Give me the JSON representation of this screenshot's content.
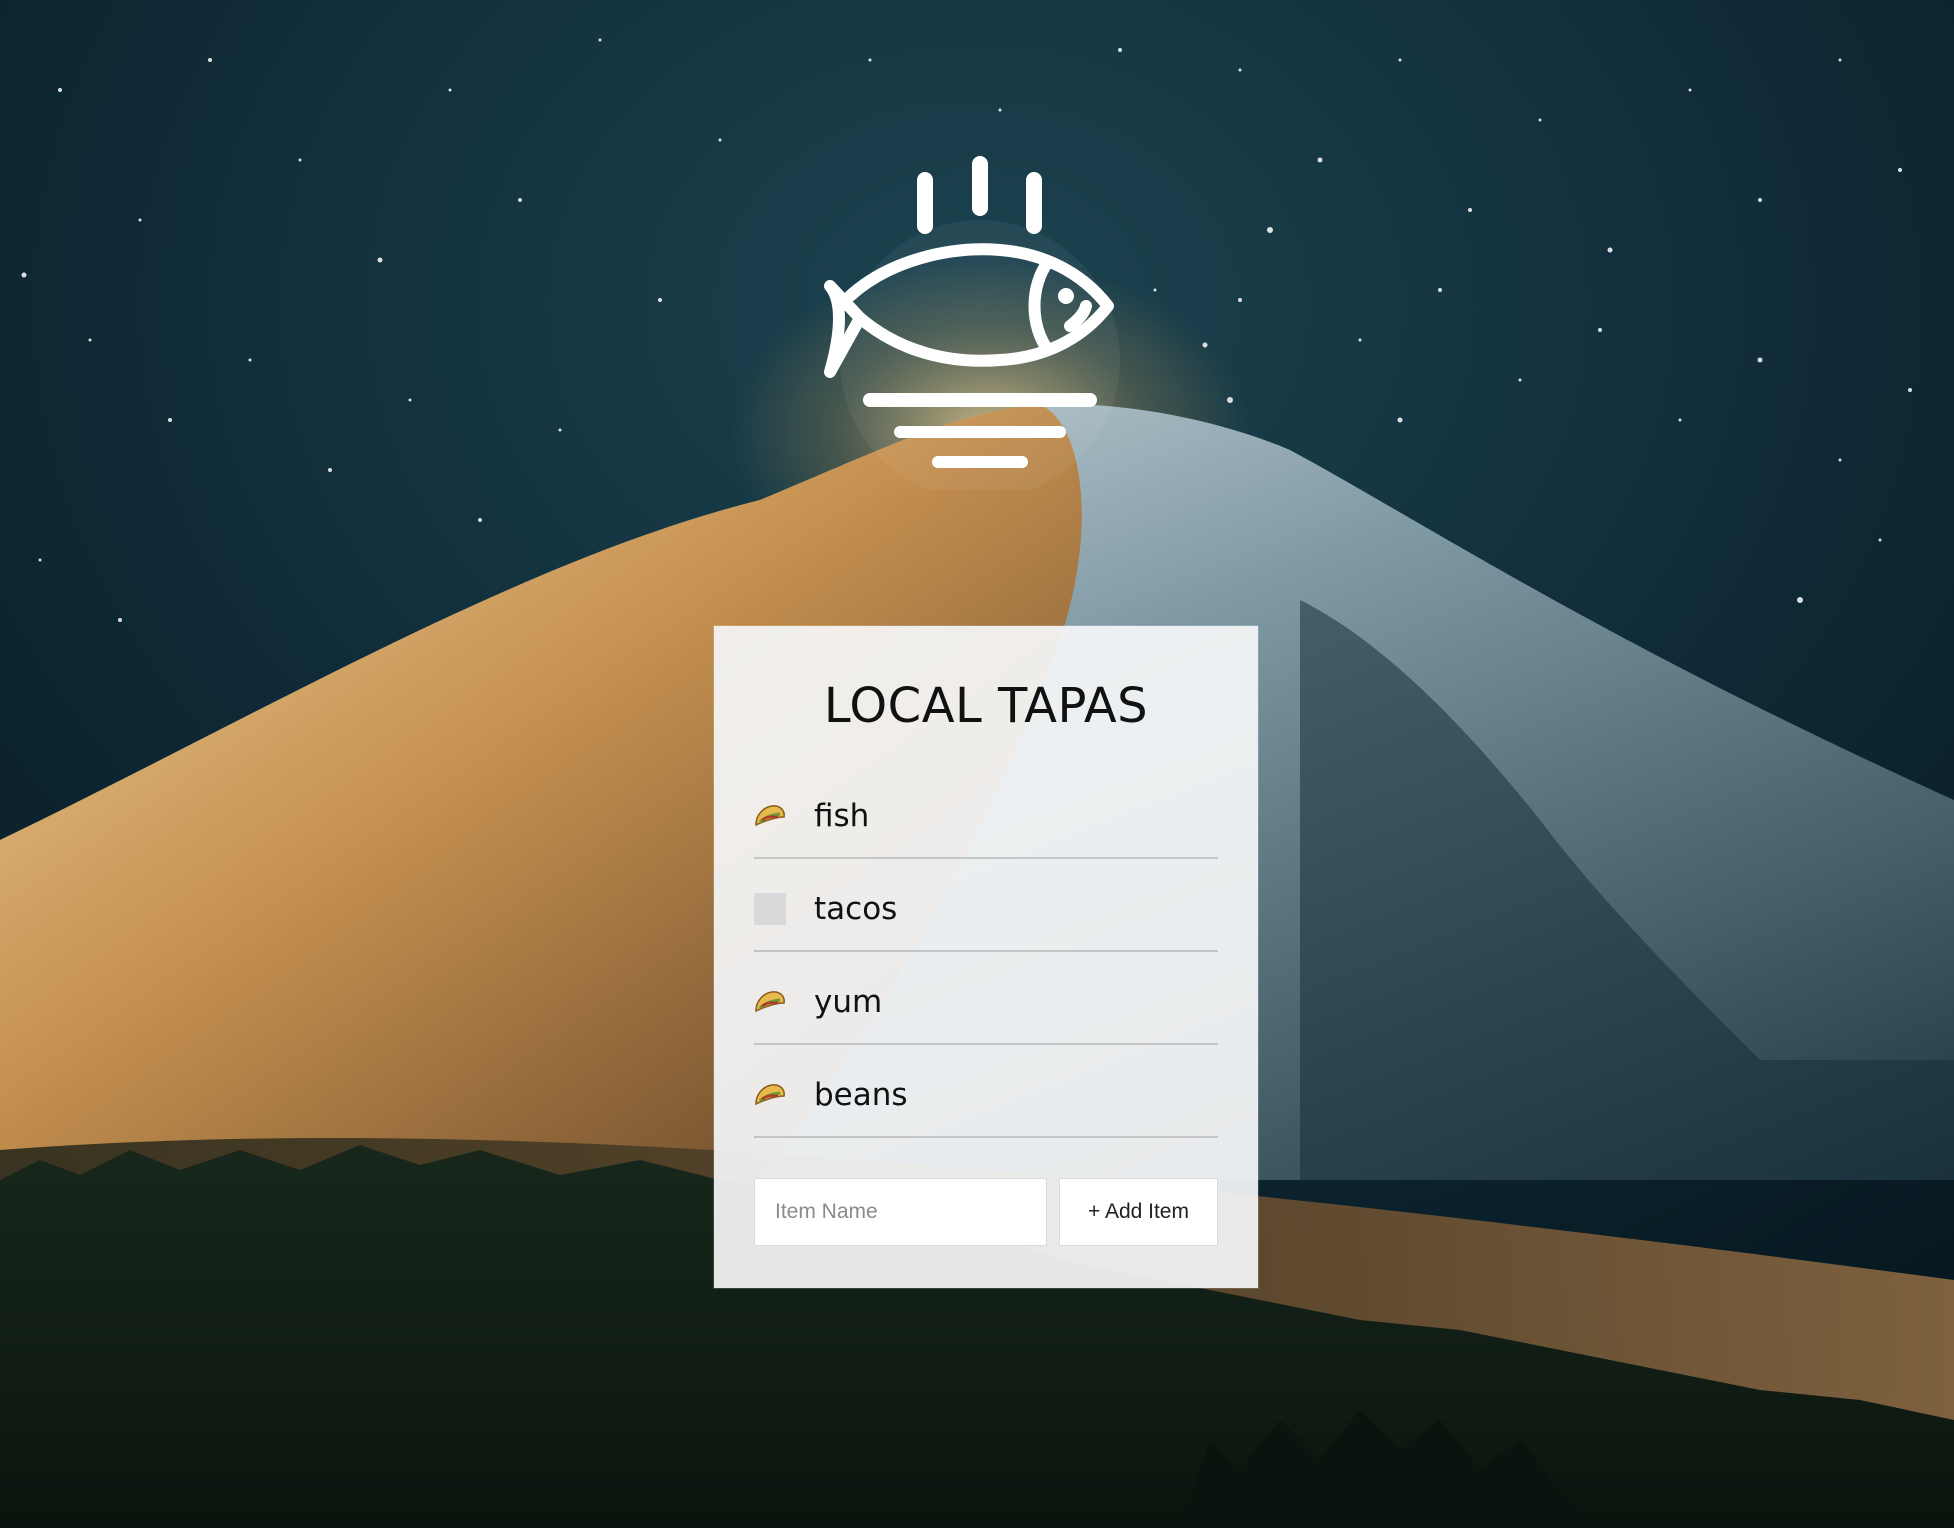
{
  "app": {
    "title": "LOCAL TAPAS"
  },
  "logo": {
    "icon": "fish-on-plate-icon"
  },
  "list": {
    "items": [
      {
        "label": "fish",
        "checked": true,
        "icon": "taco-icon"
      },
      {
        "label": "tacos",
        "checked": false,
        "icon": ""
      },
      {
        "label": "yum",
        "checked": true,
        "icon": "taco-icon"
      },
      {
        "label": "beans",
        "checked": true,
        "icon": "taco-icon"
      }
    ]
  },
  "add_form": {
    "input_value": "",
    "input_placeholder": "Item Name",
    "button_label": "+ Add Item"
  },
  "colors": {
    "card_background": "#f5f6f7",
    "text": "#111111",
    "divider": "#c4c5c6"
  }
}
